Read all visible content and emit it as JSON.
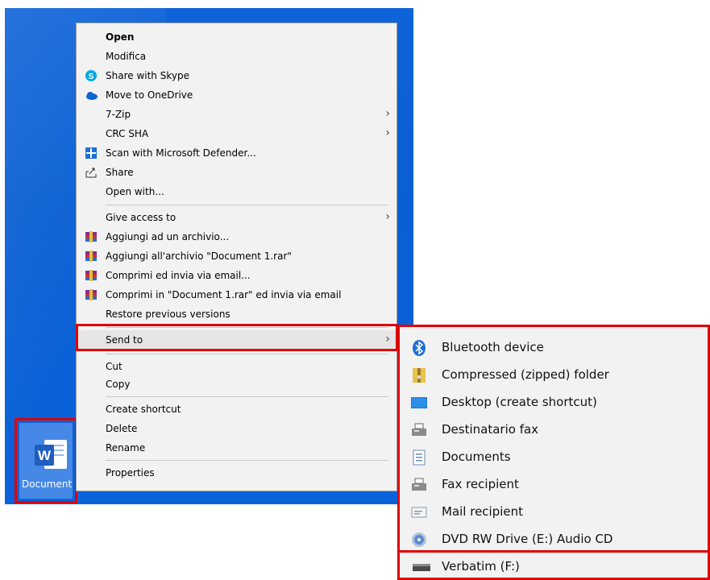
{
  "desktop_file": {
    "label": "Document"
  },
  "context_menu": {
    "items": [
      {
        "label": "Open"
      },
      {
        "label": "Modifica"
      },
      {
        "label": "Share with Skype"
      },
      {
        "label": "Move to OneDrive"
      },
      {
        "label": "7-Zip"
      },
      {
        "label": "CRC SHA"
      },
      {
        "label": "Scan with Microsoft Defender..."
      },
      {
        "label": "Share"
      },
      {
        "label": "Open with..."
      },
      {
        "label": "Give access to"
      },
      {
        "label": "Aggiungi ad un archivio..."
      },
      {
        "label": "Aggiungi all'archivio \"Document 1.rar\""
      },
      {
        "label": "Comprimi ed invia via email..."
      },
      {
        "label": "Comprimi in \"Document 1.rar\" ed invia via email"
      },
      {
        "label": "Restore previous versions"
      },
      {
        "label": "Send to"
      },
      {
        "label": "Cut"
      },
      {
        "label": "Copy"
      },
      {
        "label": "Create shortcut"
      },
      {
        "label": "Delete"
      },
      {
        "label": "Rename"
      },
      {
        "label": "Properties"
      }
    ]
  },
  "send_to_menu": {
    "items": [
      {
        "label": "Bluetooth device",
        "icon": "bluetooth-icon"
      },
      {
        "label": "Compressed (zipped) folder",
        "icon": "zip-folder-icon"
      },
      {
        "label": "Desktop (create shortcut)",
        "icon": "desktop-icon"
      },
      {
        "label": "Destinatario fax",
        "icon": "fax-icon"
      },
      {
        "label": "Documents",
        "icon": "documents-icon"
      },
      {
        "label": "Fax recipient",
        "icon": "fax-icon"
      },
      {
        "label": "Mail recipient",
        "icon": "mail-icon"
      },
      {
        "label": "DVD RW Drive (E:) Audio CD",
        "icon": "cd-icon"
      },
      {
        "label": "Verbatim (F:)",
        "icon": "usb-drive-icon"
      }
    ]
  },
  "colors": {
    "highlight": "#e00000",
    "desktop": "#0a5fd4",
    "menu_bg": "#f2f2f2"
  }
}
